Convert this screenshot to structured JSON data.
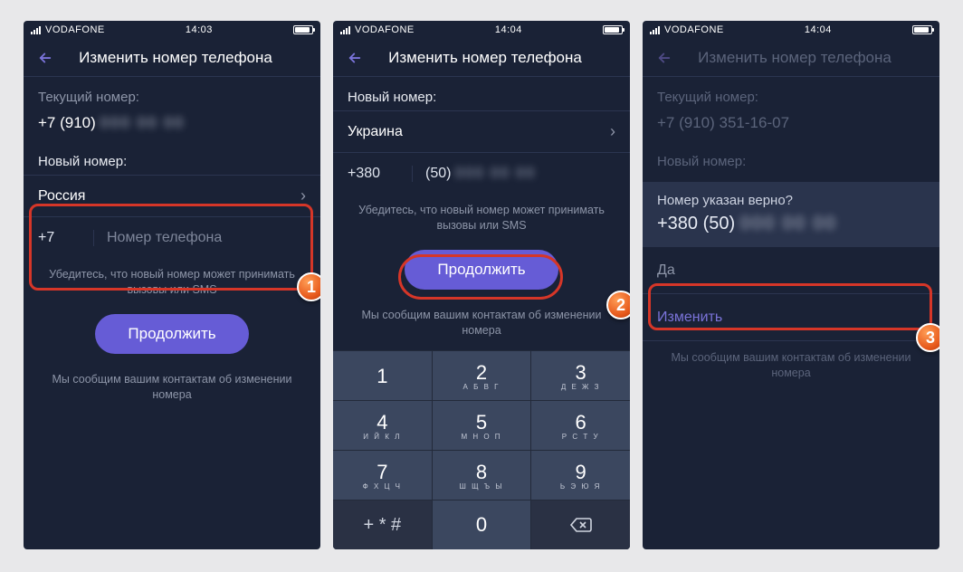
{
  "status": {
    "carrier": "VODAFONE",
    "time1": "14:03",
    "time2": "14:04",
    "time3": "14:04"
  },
  "nav_title": "Изменить номер телефона",
  "s1": {
    "current_label": "Текущий номер:",
    "current_number": "+7 (910)",
    "new_label": "Новый номер:",
    "country": "Россия",
    "prefix": "+7",
    "placeholder": "Номер телефона",
    "hint": "Убедитесь, что новый номер может принимать вызовы или SMS",
    "btn": "Продолжить",
    "footer": "Мы сообщим вашим контактам об изменении номера"
  },
  "s2": {
    "new_label": "Новый номер:",
    "country": "Украина",
    "prefix": "+380",
    "area": "(50)",
    "hint": "Убедитесь, что новый номер может принимать вызовы или SMS",
    "btn": "Продолжить",
    "footer": "Мы сообщим вашим контактам об изменении номера",
    "keys": [
      {
        "d": "1",
        "s": ""
      },
      {
        "d": "2",
        "s": "А Б В Г"
      },
      {
        "d": "3",
        "s": "Д Е Ж З"
      },
      {
        "d": "4",
        "s": "И Й К Л"
      },
      {
        "d": "5",
        "s": "М Н О П"
      },
      {
        "d": "6",
        "s": "Р С Т У"
      },
      {
        "d": "7",
        "s": "Ф Х Ц Ч"
      },
      {
        "d": "8",
        "s": "Ш Щ Ъ Ы"
      },
      {
        "d": "9",
        "s": "Ь Э Ю Я"
      }
    ]
  },
  "s3": {
    "current_label": "Текущий номер:",
    "current_number": "+7 (910) 351-16-07",
    "new_label": "Новый номер:",
    "question": "Номер указан верно?",
    "number": "+380 (50)",
    "yes": "Да",
    "edit": "Изменить",
    "footer": "Мы сообщим вашим контактам об изменении номера"
  },
  "badges": {
    "b1": "1",
    "b2": "2",
    "b3": "3"
  }
}
